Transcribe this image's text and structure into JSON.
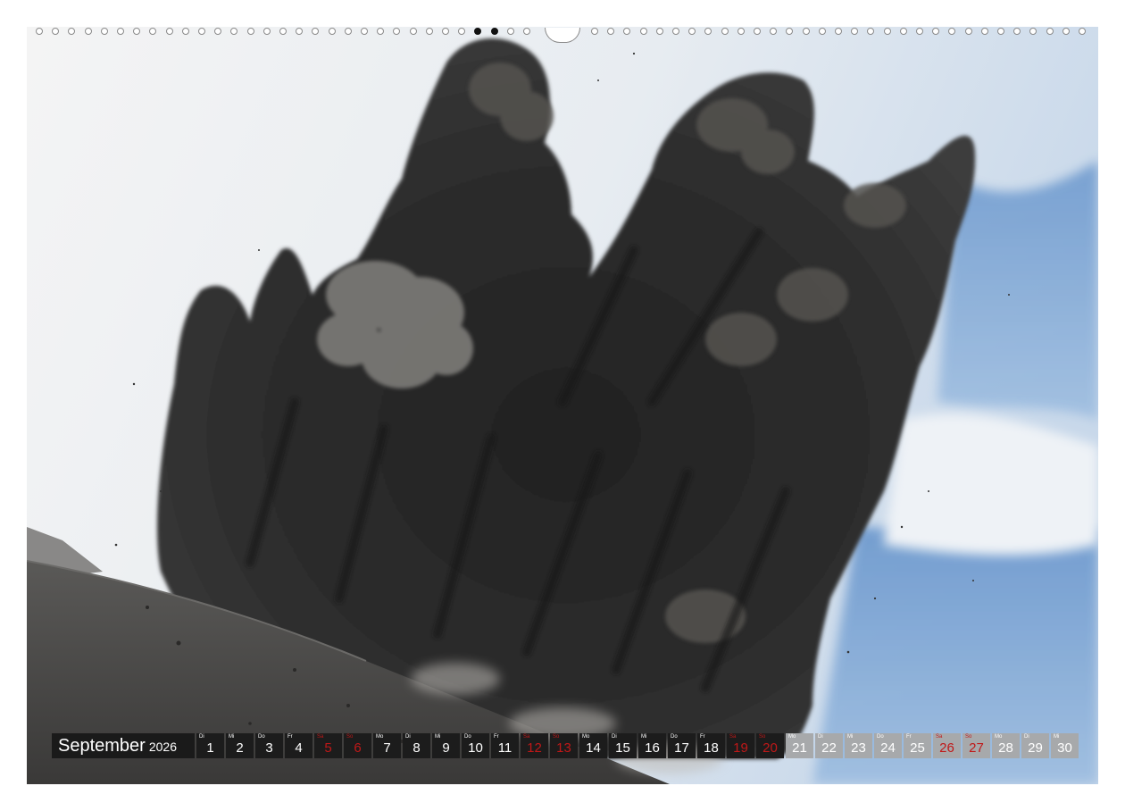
{
  "calendar": {
    "month": "September",
    "year": "2026",
    "days": [
      {
        "wd": "Di",
        "n": "1",
        "style": "dk"
      },
      {
        "wd": "Mi",
        "n": "2",
        "style": "dk"
      },
      {
        "wd": "Do",
        "n": "3",
        "style": "dk"
      },
      {
        "wd": "Fr",
        "n": "4",
        "style": "dk"
      },
      {
        "wd": "Sa",
        "n": "5",
        "style": "sun-dk"
      },
      {
        "wd": "So",
        "n": "6",
        "style": "sun-dk"
      },
      {
        "wd": "Mo",
        "n": "7",
        "style": "dk"
      },
      {
        "wd": "Di",
        "n": "8",
        "style": "dk"
      },
      {
        "wd": "Mi",
        "n": "9",
        "style": "dk"
      },
      {
        "wd": "Do",
        "n": "10",
        "style": "dk"
      },
      {
        "wd": "Fr",
        "n": "11",
        "style": "dk"
      },
      {
        "wd": "Sa",
        "n": "12",
        "style": "sun-dk"
      },
      {
        "wd": "So",
        "n": "13",
        "style": "sun-dk"
      },
      {
        "wd": "Mo",
        "n": "14",
        "style": "dk"
      },
      {
        "wd": "Di",
        "n": "15",
        "style": "dk"
      },
      {
        "wd": "Mi",
        "n": "16",
        "style": "dk"
      },
      {
        "wd": "Do",
        "n": "17",
        "style": "dk"
      },
      {
        "wd": "Fr",
        "n": "18",
        "style": "dk"
      },
      {
        "wd": "Sa",
        "n": "19",
        "style": "sun-dk"
      },
      {
        "wd": "So",
        "n": "20",
        "style": "sun-dk"
      },
      {
        "wd": "Mo",
        "n": "21",
        "style": "lt"
      },
      {
        "wd": "Di",
        "n": "22",
        "style": "lt"
      },
      {
        "wd": "Mi",
        "n": "23",
        "style": "lt"
      },
      {
        "wd": "Do",
        "n": "24",
        "style": "lt"
      },
      {
        "wd": "Fr",
        "n": "25",
        "style": "lt"
      },
      {
        "wd": "Sa",
        "n": "26",
        "style": "sun-lt"
      },
      {
        "wd": "So",
        "n": "27",
        "style": "sun-lt"
      },
      {
        "wd": "Mo",
        "n": "28",
        "style": "lt"
      },
      {
        "wd": "Di",
        "n": "29",
        "style": "lt"
      },
      {
        "wd": "Mi",
        "n": "30",
        "style": "lt"
      }
    ]
  },
  "colors": {
    "sky": "#d9e3ee",
    "blue_sky": "#6f9cd0",
    "ash": "#2c2c2c",
    "ground": "#4a4948",
    "weekend_red": "#c01818"
  }
}
